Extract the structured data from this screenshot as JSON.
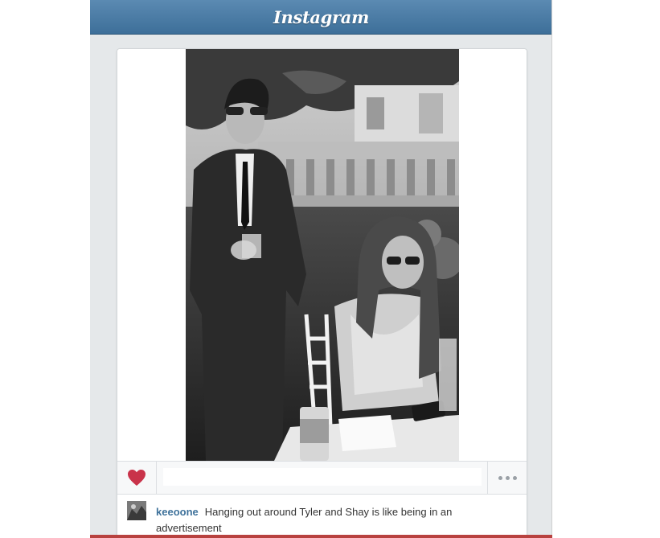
{
  "header": {
    "logo_text": "Instagram"
  },
  "post": {
    "photo_icon": "photo-image",
    "like_icon": "heart-icon",
    "like_color": "#c9334a",
    "more_icon": "ellipsis-icon",
    "username": "keeoone",
    "caption": "Hanging out around Tyler and Shay is like being in an advertisement"
  },
  "colors": {
    "header_bg": "#4a7ba5",
    "username": "#3f729b",
    "page_bg": "#e5e8ea"
  }
}
